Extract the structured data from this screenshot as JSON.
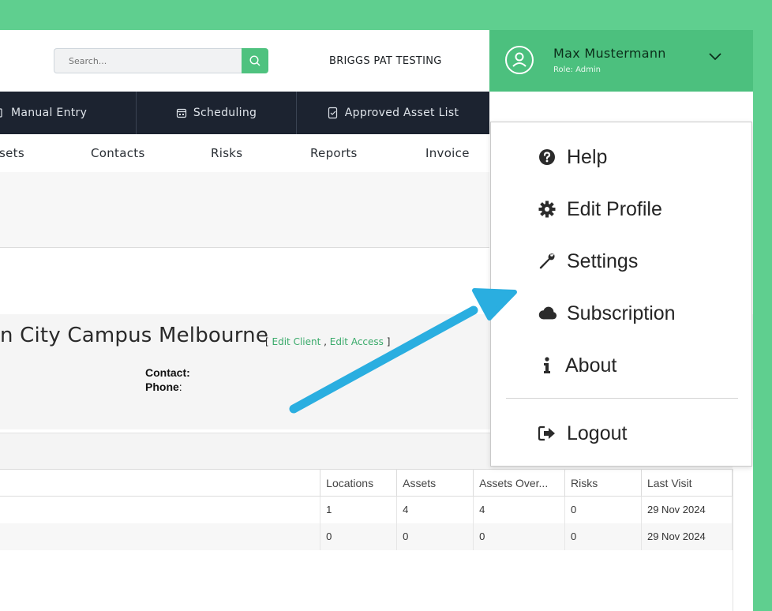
{
  "search": {
    "placeholder": "Search..."
  },
  "company": "BRIGGS PAT TESTING",
  "user": {
    "name": "Max Mustermann",
    "role": "Role: Admin"
  },
  "dark_nav": [
    {
      "label": "Manual Entry",
      "icon": "tag-icon"
    },
    {
      "label": "Scheduling",
      "icon": "calendar-icon"
    },
    {
      "label": "Approved Asset List",
      "icon": "checklist-icon"
    }
  ],
  "light_nav": [
    "sets",
    "Contacts",
    "Risks",
    "Reports",
    "Invoice"
  ],
  "client": {
    "name": "n City Campus Melbourne",
    "bracket_open": "[",
    "edit_client": "Edit Client",
    "separator": " , ",
    "edit_access": "Edit Access",
    "bracket_close": "]",
    "contact_label": "Contact:",
    "phone_label": "Phone",
    "phone_colon": ":"
  },
  "table": {
    "headers": [
      "Locations",
      "Assets",
      "Assets Over...",
      "Risks",
      "Last Visit"
    ],
    "rows": [
      [
        "1",
        "4",
        "4",
        "0",
        "29 Nov 2024"
      ],
      [
        "0",
        "0",
        "0",
        "0",
        "29 Nov 2024"
      ]
    ]
  },
  "menu": {
    "items": [
      {
        "label": "Help",
        "icon": "question-circle-icon"
      },
      {
        "label": "Edit Profile",
        "icon": "gear-icon"
      },
      {
        "label": "Settings",
        "icon": "wrench-icon"
      },
      {
        "label": "Subscription",
        "icon": "cloud-icon"
      },
      {
        "label": "About",
        "icon": "info-icon"
      }
    ],
    "logout": {
      "label": "Logout",
      "icon": "sign-out-icon"
    }
  },
  "colors": {
    "brand_green": "#4cc07e",
    "nav_dark": "#1c2330",
    "link_green": "#3aaa6a",
    "arrow_blue": "#2aaee0"
  }
}
